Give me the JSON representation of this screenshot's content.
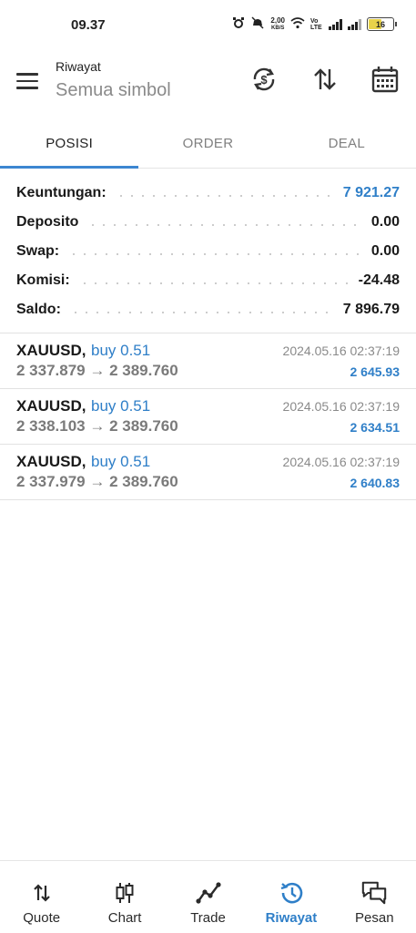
{
  "status_bar": {
    "time": "09.37",
    "net_speed_value": "2,00",
    "net_speed_unit": "KB/S",
    "lte_label": "Vo LTE",
    "battery": "16"
  },
  "toolbar": {
    "title": "Riwayat",
    "subtitle": "Semua simbol"
  },
  "tabs": [
    {
      "label": "POSISI",
      "active": true
    },
    {
      "label": "ORDER",
      "active": false
    },
    {
      "label": "DEAL",
      "active": false
    }
  ],
  "summary": [
    {
      "label": "Keuntungan:",
      "value": "7 921.27"
    },
    {
      "label": "Deposito",
      "value": "0.00"
    },
    {
      "label": "Swap:",
      "value": "0.00"
    },
    {
      "label": "Komisi:",
      "value": "-24.48"
    },
    {
      "label": "Saldo:",
      "value": "7 896.79"
    }
  ],
  "deals": [
    {
      "symbol": "XAUUSD,",
      "type": "buy 0.51",
      "prices": "2 337.879 → 2 389.760",
      "time": "2024.05.16 02:37:19",
      "profit": "2 645.93"
    },
    {
      "symbol": "XAUUSD,",
      "type": "buy 0.51",
      "prices": "2 338.103 → 2 389.760",
      "time": "2024.05.16 02:37:19",
      "profit": "2 634.51"
    },
    {
      "symbol": "XAUUSD,",
      "type": "buy 0.51",
      "prices": "2 337.979 → 2 389.760",
      "time": "2024.05.16 02:37:19",
      "profit": "2 640.83"
    }
  ],
  "bottom_nav": [
    {
      "label": "Quote",
      "icon": "quote-icon"
    },
    {
      "label": "Chart",
      "icon": "chart-icon"
    },
    {
      "label": "Trade",
      "icon": "trade-icon"
    },
    {
      "label": "Riwayat",
      "icon": "history-icon",
      "active": true
    },
    {
      "label": "Pesan",
      "icon": "messages-icon"
    }
  ],
  "colors": {
    "accent": "#2f7fc8",
    "tab_underline": "#3d86d1",
    "muted_text": "#8a8a8a"
  }
}
